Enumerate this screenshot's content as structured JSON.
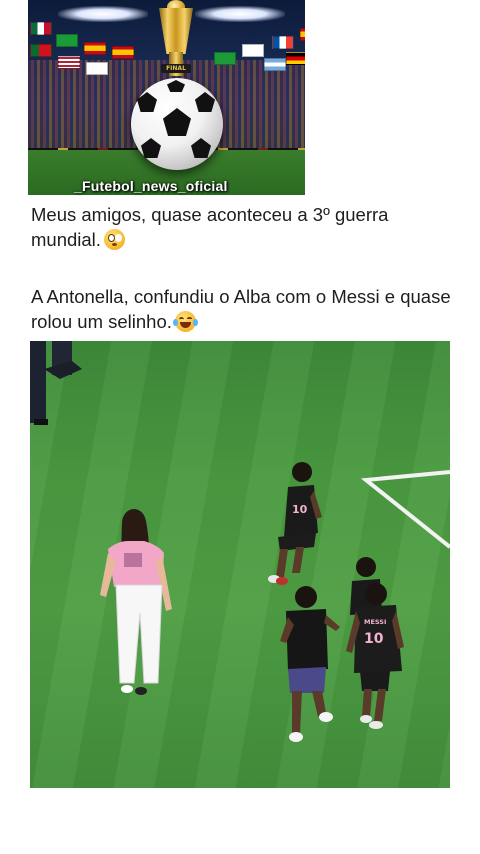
{
  "header_image": {
    "watermark": "_Futebol_news_oficial",
    "trophy_label": "FINAL"
  },
  "post": {
    "paragraph_1": "Meus amigos, quase aconteceu a 3º guerra mundial.",
    "paragraph_2": "A Antonella, confundiu o Alba com o Messi e quase rolou um selinho."
  },
  "emojis": {
    "paragraph_1_end": "flushed-face-emoji",
    "paragraph_2_end": "face-with-tears-of-joy-emoji"
  },
  "main_photo": {
    "jersey_numbers": [
      "10"
    ],
    "jersey_names": [
      "MESSI"
    ]
  },
  "colors": {
    "text": "#1e1e1e",
    "background": "#ffffff",
    "pitch": "#4a9a40",
    "shirt_pink": "#f2a6c8",
    "jersey_black": "#1a1a1a"
  }
}
